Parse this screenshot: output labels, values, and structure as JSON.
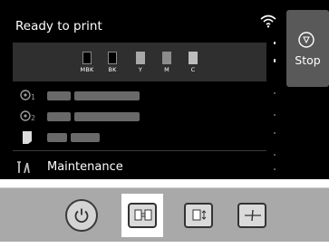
{
  "lcd": {
    "status": "Ready to print",
    "stop_label": "Stop",
    "inks": [
      {
        "name": "MBK",
        "color": "#000000"
      },
      {
        "name": "BK",
        "color": "#000000"
      },
      {
        "name": "Y",
        "color": "#a8a8a8"
      },
      {
        "name": "M",
        "color": "#8c8c8c"
      },
      {
        "name": "C",
        "color": "#bdbdbd"
      }
    ],
    "rows": [
      {
        "icon": "roll-1-icon"
      },
      {
        "icon": "roll-2-icon"
      },
      {
        "icon": "cut-sheet-icon"
      }
    ],
    "maintenance_label": "Maintenance"
  },
  "panel": {
    "buttons": [
      "power-button",
      "feed-mode-button",
      "roll-feed-button",
      "cut-button"
    ]
  }
}
